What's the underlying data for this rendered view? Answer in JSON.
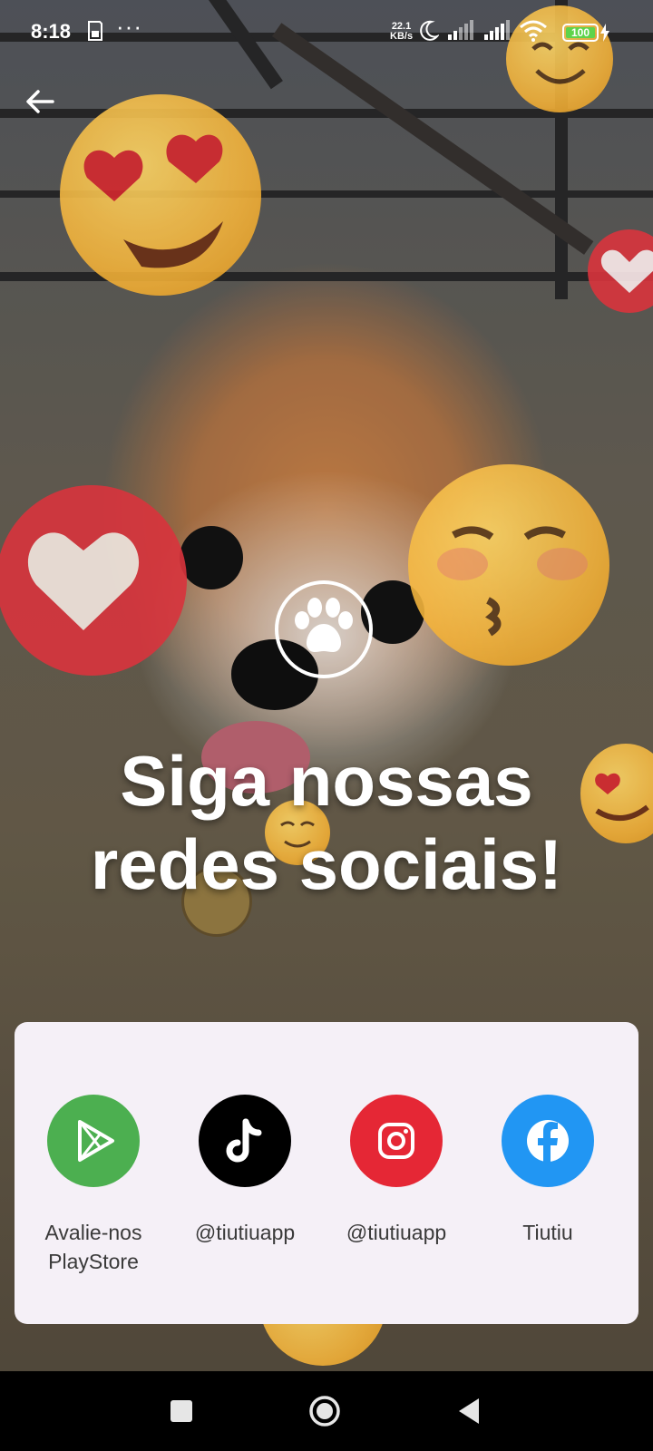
{
  "status_bar": {
    "time": "8:18",
    "net_speed": "22.1",
    "net_unit": "KB/s",
    "battery": "100"
  },
  "hero": {
    "title_line1": "Siga nossas",
    "title_line2": "redes sociais!"
  },
  "social_links": [
    {
      "label_line1": "Avalie-nos",
      "label_line2": "PlayStore",
      "icon": "play-store-icon",
      "color": "#4caf50"
    },
    {
      "label_line1": "@tiutiuapp",
      "label_line2": "",
      "icon": "tiktok-icon",
      "color": "#000000"
    },
    {
      "label_line1": "@tiutiuapp",
      "label_line2": "",
      "icon": "instagram-icon",
      "color": "#e52735"
    },
    {
      "label_line1": "Tiutiu",
      "label_line2": "",
      "icon": "facebook-icon",
      "color": "#2196f3"
    }
  ],
  "nav_bar": {
    "buttons": [
      "recents-button",
      "home-button",
      "back-button"
    ]
  }
}
